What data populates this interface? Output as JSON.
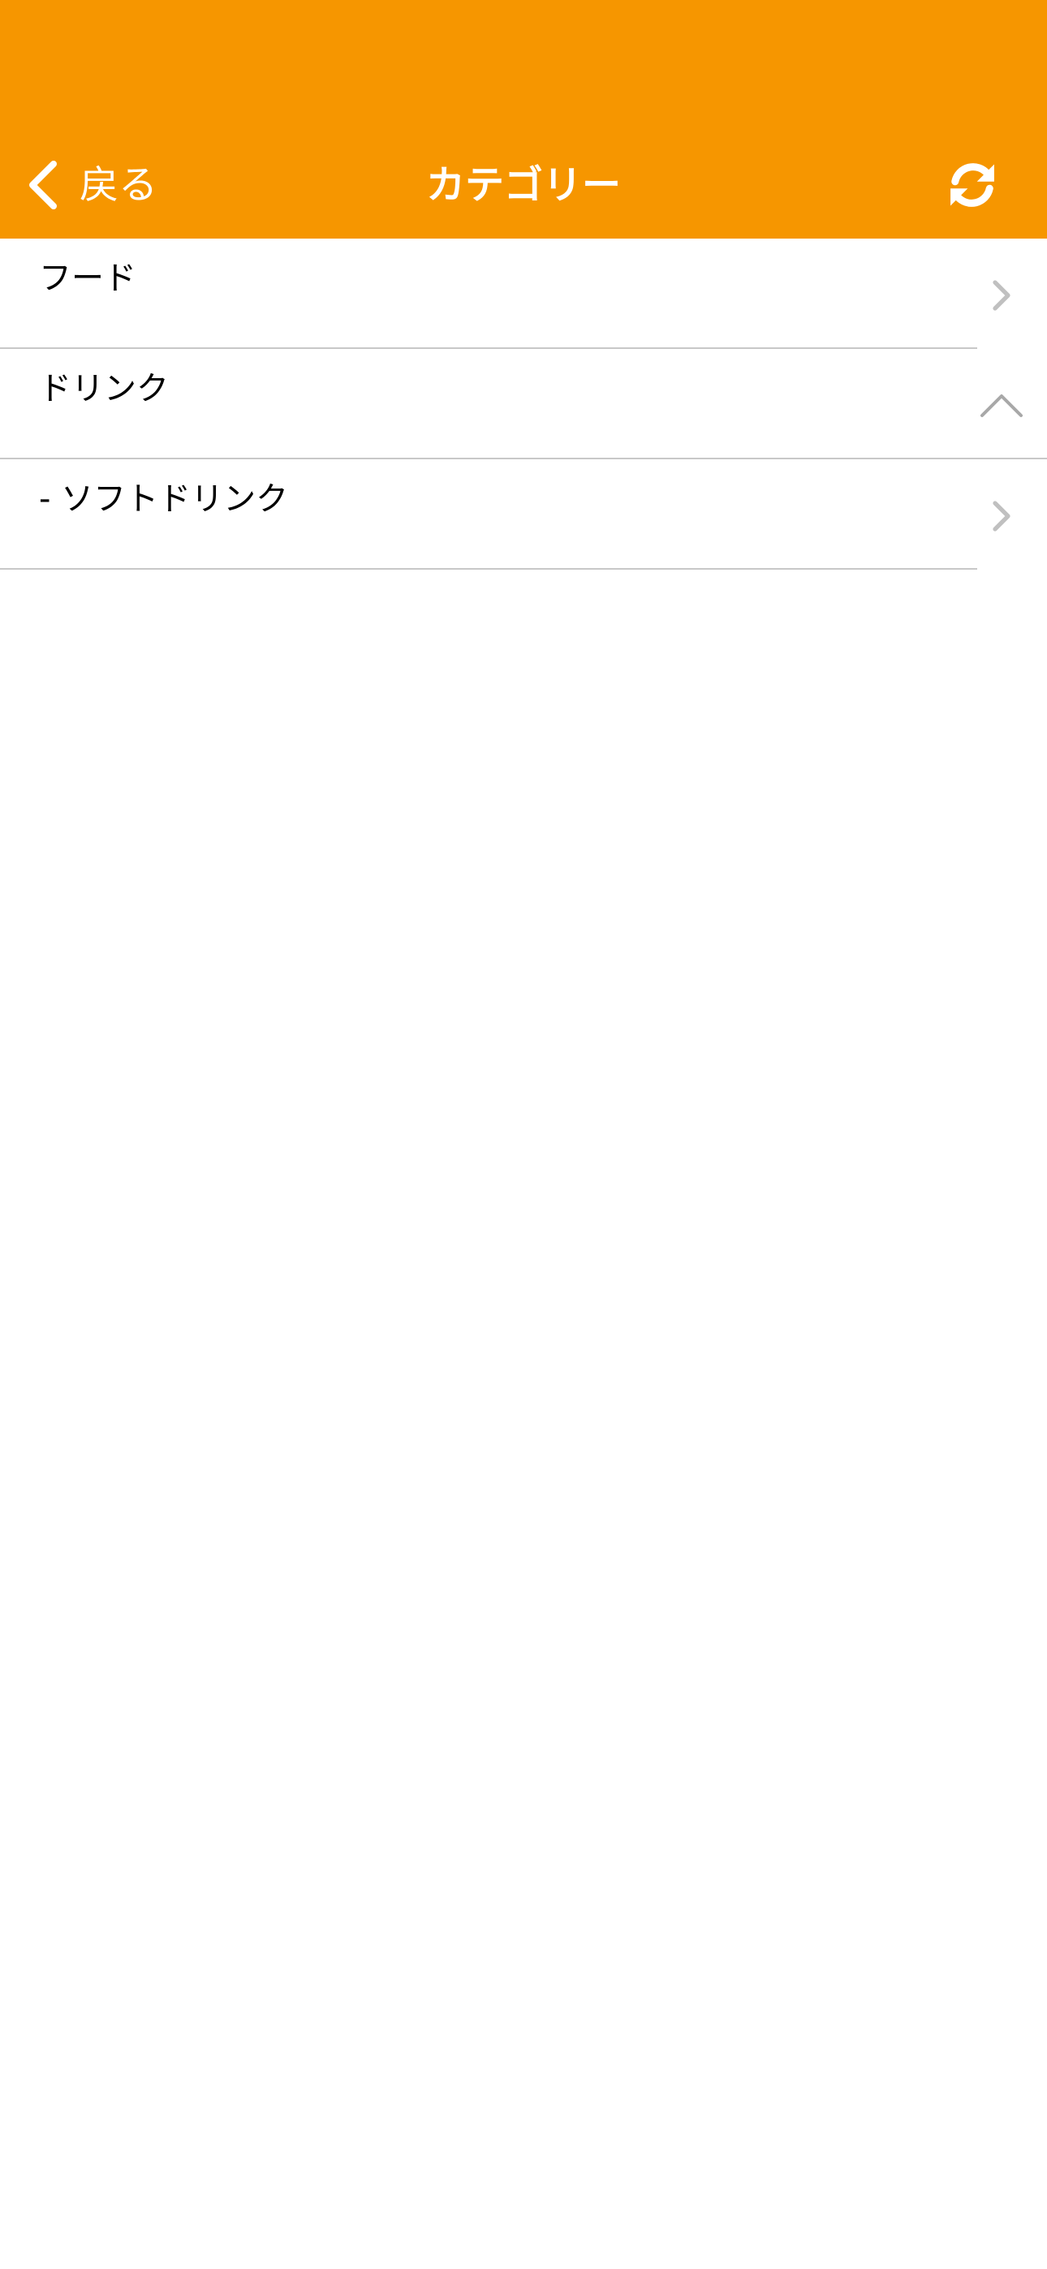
{
  "header": {
    "back_label": "戻る",
    "title": "カテゴリー",
    "back_icon": "chevron-left-icon",
    "refresh_icon": "refresh-icon"
  },
  "categories": {
    "items": [
      {
        "label": "フード",
        "accessory": "chevron-right-icon",
        "expanded": false
      },
      {
        "label": "ドリンク",
        "accessory": "chevron-up-icon",
        "expanded": true
      },
      {
        "label": "- ソフトドリンク",
        "accessory": "chevron-right-icon",
        "expanded": false
      }
    ]
  },
  "colors": {
    "accent": "#f69600",
    "navbar_text": "#ffffff",
    "row_text": "#000000",
    "divider": "#c8c8c8",
    "chevron": "#c0c0c0"
  }
}
